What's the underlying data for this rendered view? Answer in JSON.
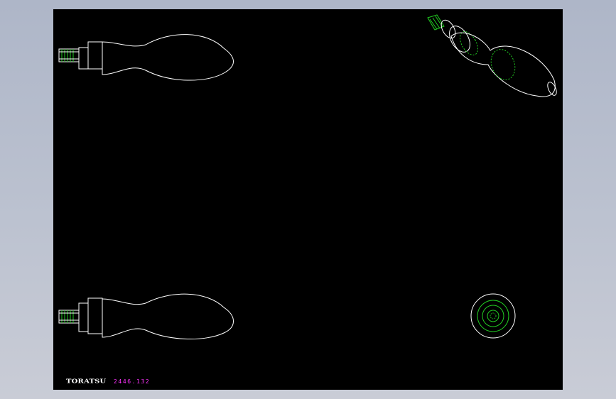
{
  "title_block": {
    "logo": "TORATSU",
    "part_number": "2446.132"
  },
  "views": [
    {
      "name": "front-view"
    },
    {
      "name": "isometric-view"
    },
    {
      "name": "bottom-view"
    },
    {
      "name": "end-view"
    }
  ],
  "colors": {
    "background": "#aeb6c8",
    "sheet": "#000000",
    "outline": "#ffffff",
    "hidden_detail": "#22cc22",
    "annotation": "#ff33ff"
  }
}
